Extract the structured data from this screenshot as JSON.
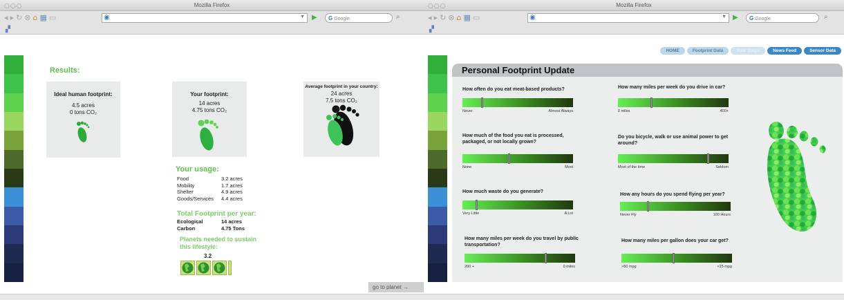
{
  "left_window": {
    "title": "Mozilla Firefox",
    "search_placeholder": "Google",
    "results_title": "Results:",
    "cards": [
      {
        "heading": "Ideal human footprint:",
        "acres": "4.5 acres",
        "co2": "0 tons CO₂"
      },
      {
        "heading": "Your footprint:",
        "acres": "14 acres",
        "co2": "4.75 tons CO₂"
      },
      {
        "heading": "Average footprint in your country:",
        "acres": "24 acres",
        "co2": "7.5 tons CO₂"
      }
    ],
    "usage": {
      "title": "Your usage:",
      "rows": [
        {
          "label": "Food",
          "value": "3.2 acres"
        },
        {
          "label": "Mobility",
          "value": "1.7 acres"
        },
        {
          "label": "Shelter",
          "value": "4.9 acres"
        },
        {
          "label": "Goods/Services",
          "value": "4.4 acres"
        }
      ]
    },
    "total": {
      "title": "Total Footprint per year:",
      "rows": [
        {
          "label": "Ecological",
          "value": "14 acres"
        },
        {
          "label": "Carbon",
          "value": "4.75 Tons"
        }
      ]
    },
    "planets": {
      "title": "Planets needed to sustain this lifestyle:",
      "value": "3.2"
    },
    "go_to_planet": "go to planet →"
  },
  "right_window": {
    "title": "Mozilla Firefox",
    "search_placeholder": "Google",
    "nav": [
      "HOME",
      "Footprint Data",
      "Your Steps",
      "News Feed",
      "Sensor Data"
    ],
    "panel_title": "Personal Footprint Update",
    "questions": [
      {
        "text": "How often do you eat meat-based products?",
        "left": "Never",
        "right": "Almost Always",
        "level": 0.17
      },
      {
        "text": "How many miles per week do you drive in car?",
        "left": "0 miles",
        "right": "400+",
        "level": 0.3
      },
      {
        "text": "How much of the food you eat is processed, packaged, or not locally grown?",
        "left": "None",
        "right": "Most",
        "level": 0.42
      },
      {
        "text": "Do you bicycle, walk or use animal power to get around?",
        "left": "Most of the time",
        "right": "Seldom",
        "level": 0.82
      },
      {
        "text": "How much waste do you generate?",
        "left": "Very Little",
        "right": "A Lot",
        "level": 0.12
      },
      {
        "text": "How any hours do you spend flying per year?",
        "left": "Never Fly",
        "right": "100 Hours",
        "level": 0.25
      },
      {
        "text": "How many miles per week do you travel by public transportation?",
        "left": "200 +",
        "right": "0 miles",
        "level": 0.74
      },
      {
        "text": "How many miles per gallon does your car get?",
        "left": ">50 mpg",
        "right": "<15 mpg",
        "level": 0.47
      }
    ]
  },
  "colors": {
    "strip": [
      "#2fae3a",
      "#3fc24a",
      "#5ed14f",
      "#9ad760",
      "#7aa23a",
      "#4e6a28",
      "#2a3a16",
      "#3b90d6",
      "#3c5aa8",
      "#2b3a78",
      "#1f2a50",
      "#162040"
    ],
    "accent_green": "#5fbf4f",
    "nav_active": "#3b88c4"
  }
}
